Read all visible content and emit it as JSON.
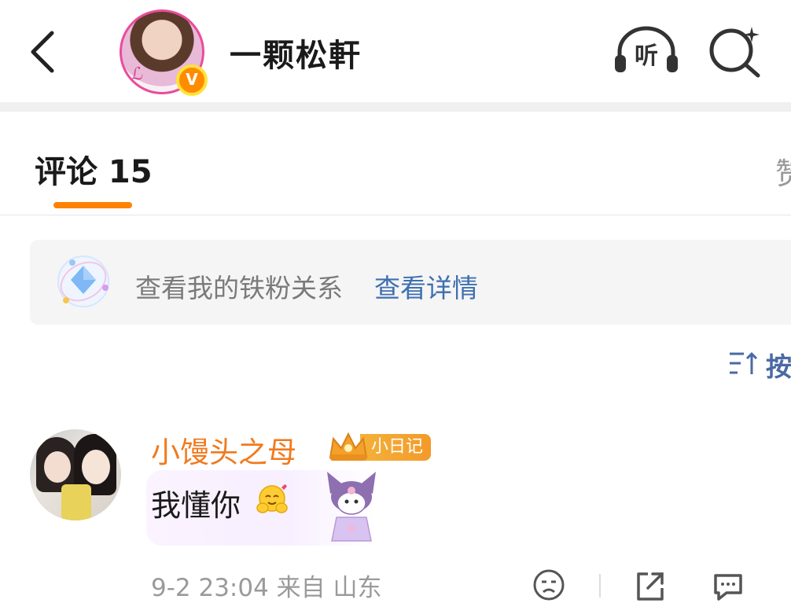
{
  "header": {
    "author_name": "一颗松軒",
    "verified_badge": "V",
    "listen_label": "听",
    "icons": [
      "back-icon",
      "headphones-icon",
      "search-sparkle-icon"
    ]
  },
  "tabs": {
    "comments_label": "评论 15",
    "likes_label": "赞"
  },
  "fan_banner": {
    "text": "查看我的铁粉关系",
    "link": "查看详情",
    "icon": "diamond-orbit-icon"
  },
  "sort": {
    "label": "按",
    "icon": "sort-icon"
  },
  "comment": {
    "username": "小馒头之母",
    "badge": "小日记",
    "text": "我懂你",
    "meta": "9-2 23:04  来自 山东",
    "icons": [
      "crown-icon",
      "hug-emoji-icon",
      "dislike-icon",
      "share-icon",
      "reply-icon"
    ]
  },
  "colors": {
    "accent": "#ff8200",
    "username": "#f07a1e",
    "link": "#3f6fb0",
    "verified": "#ff8c00"
  }
}
